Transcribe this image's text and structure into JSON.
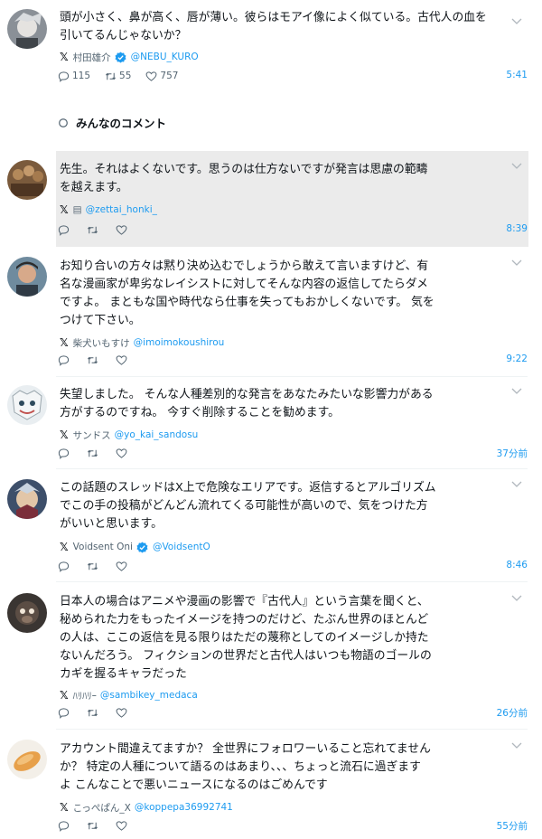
{
  "main_post": {
    "text": "頭が小さく、鼻が高く、唇が薄い。彼らはモアイ像によく似ている。古代人の血を\n引いてるんじゃないか？",
    "name": "村田雄介",
    "handle": "@NEBU_KURO",
    "replies": "115",
    "reposts": "55",
    "likes": "757",
    "time": "5:41"
  },
  "section_title": "みんなのコメント",
  "comments": [
    {
      "text": "先生。それはよくないです。思うのは仕方ないですが発言は思慮の範疇\nを越えます。",
      "name": "▤",
      "handle": "@zettai_honki_",
      "time": "8:39"
    },
    {
      "text": "お知り合いの方々は黙り決め込むでしょうから敢えて言いますけど、有\n名な漫画家が卑劣なレイシストに対してそんな内容の返信してたらダメ\nですよ。 まともな国や時代なら仕事を失ってもおかしくないです。 気を\nつけて下さい。",
      "name": "柴犬いもすけ",
      "handle": "@imoimokoushirou",
      "time": "9:22"
    },
    {
      "text": "失望しました。 そんな人種差別的な発言をあなたみたいな影響力がある\n方がするのですね。 今すぐ削除することを勧めます。",
      "name": "サンドス",
      "handle": "@yo_kai_sandosu",
      "time": "37分前"
    },
    {
      "text": "この話題のスレッドはX上で危険なエリアです。返信するとアルゴリズム\nでこの手の投稿がどんどん流れてくる可能性が高いので、気をつけた方\nがいいと思います。",
      "name": "Voidsent Oni",
      "handle": "@VoidsentO",
      "time": "8:46"
    },
    {
      "text": "日本人の場合はアニメや漫画の影響で『古代人』という言葉を聞くと、\n秘められた力をもったイメージを持つのだけど、たぶん世界のほとんど\nの人は、ここの返信を見る限りはただの蔑称としてのイメージしか持た\nないんだろう。 フィクションの世界だと古代人はいつも物語のゴールの\nカギを握るキャラだった",
      "name": "ﾊﾘﾊﾘｰ",
      "handle": "@sambikey_medaca",
      "time": "26分前"
    },
    {
      "text": "アカウント間違えてますか？ 全世界にフォロワーいること忘れてません\nか？ 特定の人種について語るのはあまり、、、ちょっと流石に過ぎます\nよ こんなことで悪いニュースになるのはごめんです",
      "name": "こっぺぱん_X",
      "handle": "@koppepa36992741",
      "time": "55分前"
    }
  ],
  "icons": {
    "reply": "reply-icon",
    "repost": "repost-icon",
    "like": "heart-icon",
    "verified": "verified-badge-icon",
    "more": "chevron-down-icon",
    "search": "search-icon"
  },
  "colors": {
    "accent": "#1d9bf0",
    "text": "#0f1419",
    "muted": "#536471",
    "highlight": "#ebebeb"
  }
}
